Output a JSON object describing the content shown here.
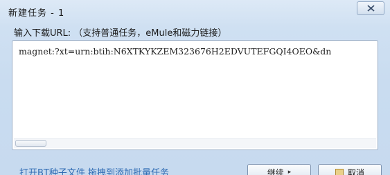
{
  "window": {
    "title": "新建任务 - 1"
  },
  "prompt": {
    "label": "输入下载URL: （支持普通任务，eMule和磁力链接）"
  },
  "url_field": {
    "value": "magnet:?xt=urn:btih:N6XTKYKZEM323676H2EDVUTEFGQI4OEO&dn"
  },
  "footer": {
    "link_text": "打开BT种子文件  拖拽到添加批量任务",
    "continue_label": "继续",
    "continue_arrow": "▸",
    "cancel_label": "取消"
  },
  "icons": {
    "close": "close-icon",
    "cancel": "cancel-icon"
  }
}
